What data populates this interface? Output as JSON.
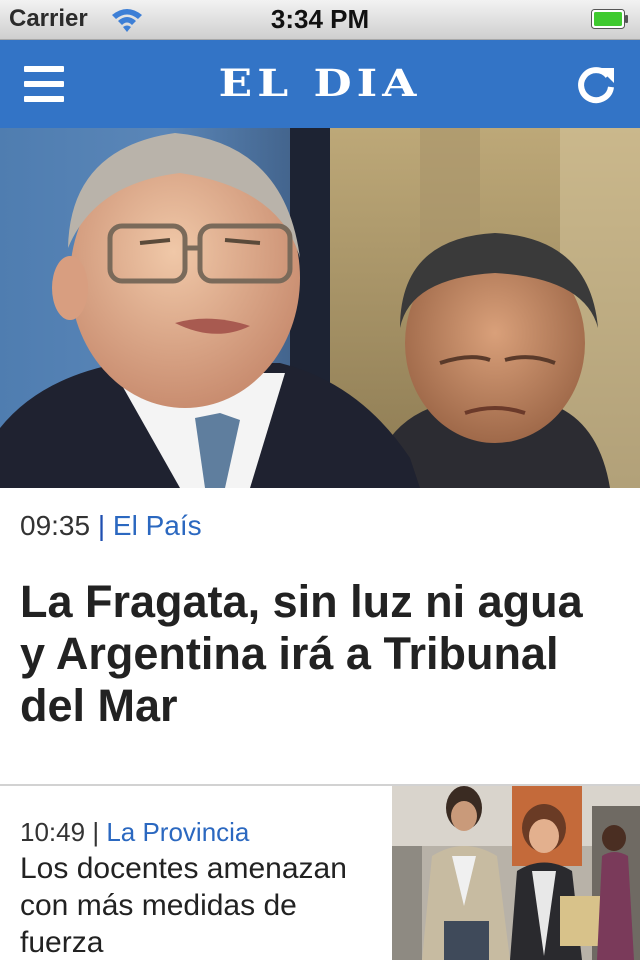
{
  "status_bar": {
    "carrier": "Carrier",
    "time": "3:34 PM"
  },
  "nav": {
    "brand": "EL DIA",
    "menu_icon": "hamburger-menu-icon",
    "refresh_icon": "refresh-icon",
    "color": "#3374c6"
  },
  "featured": {
    "time": "09:35",
    "separator": "|",
    "category": "El País",
    "headline": "La Fragata, sin luz ni agua y Argentina irá a Tribunal del Mar"
  },
  "articles": [
    {
      "time": "10:49",
      "separator": "|",
      "category": "La Provincia",
      "title": "Los docentes amenazan con más medidas de fuerza"
    }
  ],
  "colors": {
    "accent": "#3374c6",
    "category_link": "#2b68c0",
    "text": "#222222"
  }
}
